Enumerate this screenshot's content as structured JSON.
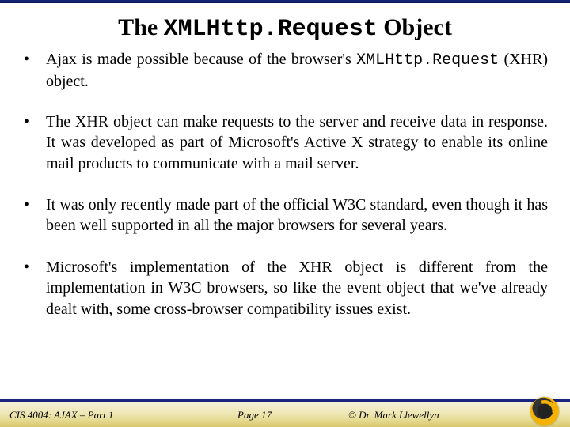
{
  "title": {
    "pre": "The ",
    "mono": "XMLHttp.Request",
    "post": " Object"
  },
  "bullets": [
    {
      "pre": "Ajax is made possible because of the browser's ",
      "mono": "XMLHttp.Request",
      "post": " (XHR) object."
    },
    {
      "pre": "The XHR object can make requests to the server and receive data in response.  It was developed as part of Microsoft's Active X strategy to enable its online mail products to communicate with a mail server.",
      "mono": "",
      "post": ""
    },
    {
      "pre": "It was only recently made part of the official W3C standard, even though it has been well supported in all the major browsers for several years.",
      "mono": "",
      "post": ""
    },
    {
      "pre": "Microsoft's implementation of the XHR object is different from the implementation in W3C browsers,  so like the event object that we've already dealt with, some cross-browser compatibility issues exist.",
      "mono": "",
      "post": ""
    }
  ],
  "footer": {
    "course": "CIS 4004: AJAX – Part 1",
    "page": "Page 17",
    "copyright": "© Dr. Mark Llewellyn"
  }
}
